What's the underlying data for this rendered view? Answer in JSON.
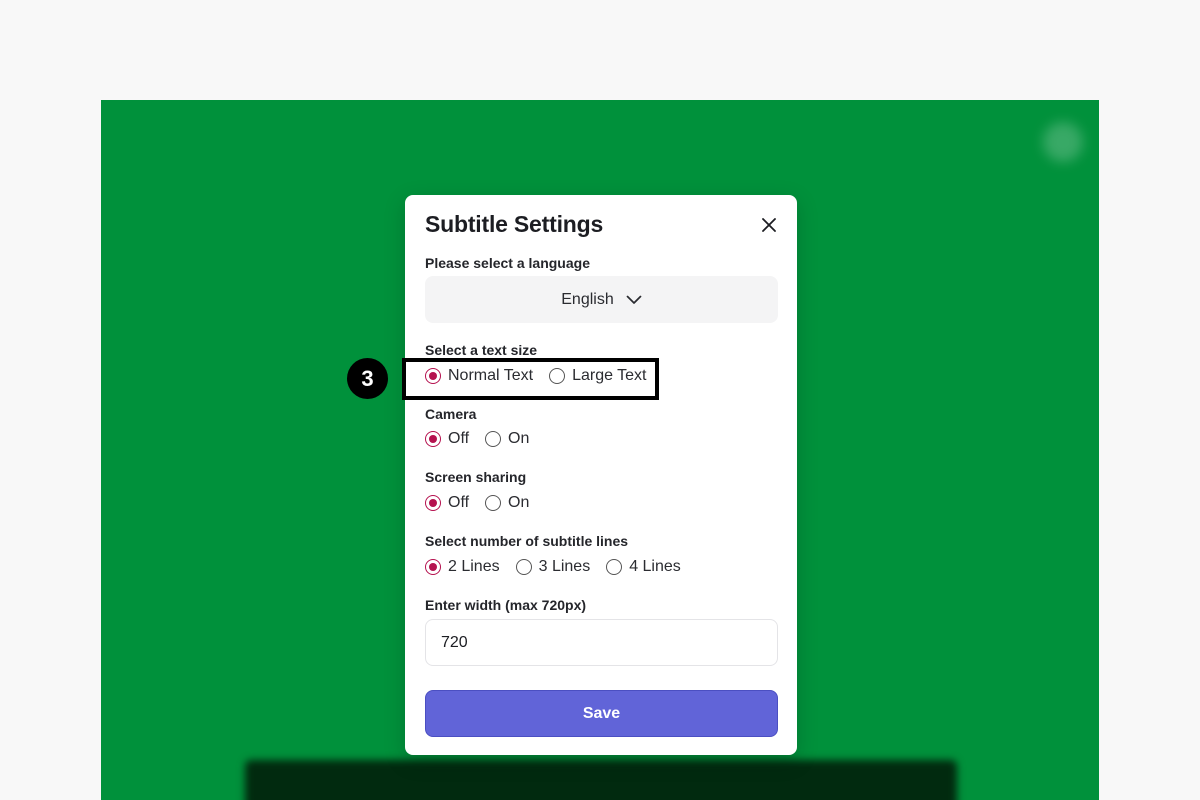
{
  "modal": {
    "title": "Subtitle Settings",
    "language": {
      "label": "Please select a language",
      "selected": "English"
    },
    "text_size": {
      "label": "Select a text size",
      "options": [
        "Normal Text",
        "Large Text"
      ],
      "selected": "Normal Text"
    },
    "camera": {
      "label": "Camera",
      "options": [
        "Off",
        "On"
      ],
      "selected": "Off"
    },
    "screen_sharing": {
      "label": "Screen sharing",
      "options": [
        "Off",
        "On"
      ],
      "selected": "Off"
    },
    "subtitle_lines": {
      "label": "Select number of subtitle lines",
      "options": [
        "2 Lines",
        "3 Lines",
        "4 Lines"
      ],
      "selected": "2 Lines"
    },
    "width": {
      "label": "Enter width (max 720px)",
      "value": "720"
    },
    "save_label": "Save"
  },
  "annotation": {
    "step_number": "3"
  },
  "colors": {
    "background": "#00913b",
    "accent_radio": "#b5124f",
    "save_button": "#6164d8"
  }
}
